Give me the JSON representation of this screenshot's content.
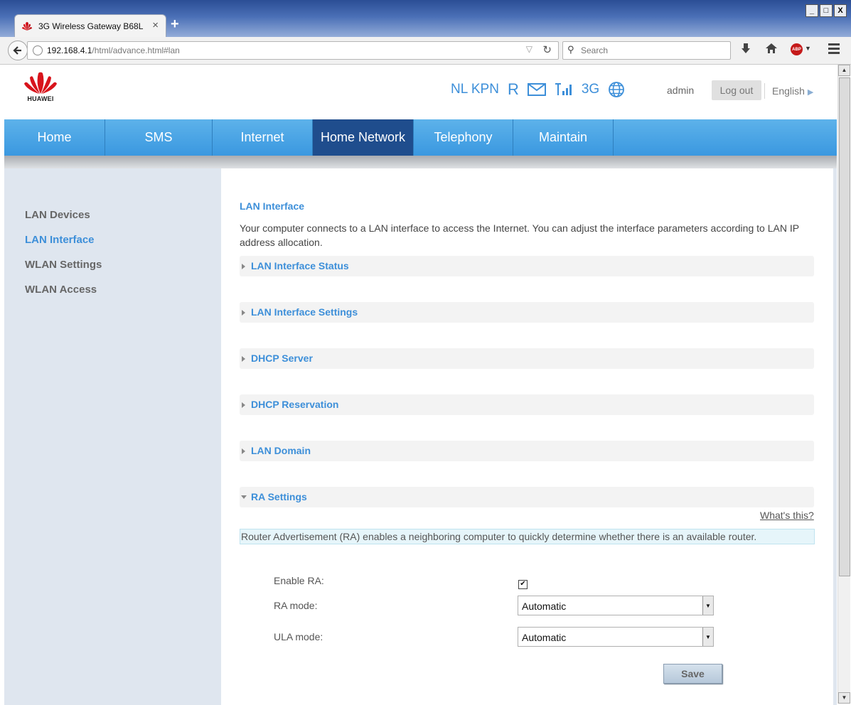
{
  "browser": {
    "tab_title": "3G Wireless Gateway B68L",
    "tab_close": "×",
    "new_tab": "+",
    "url_host": "192.168.4.1",
    "url_path": "/html/advance.html#lan",
    "search_placeholder": "Search",
    "window_buttons": [
      "_",
      "□",
      "X"
    ],
    "abp_label": "ABP"
  },
  "header": {
    "brand": "HUAWEI",
    "operator": "NL KPN",
    "roaming": "R",
    "network_type": "3G",
    "user": "admin",
    "logout_label": "Log out",
    "language": "English"
  },
  "nav": {
    "items": [
      "Home",
      "SMS",
      "Internet",
      "Home Network",
      "Telephony",
      "Maintain"
    ],
    "active": "Home Network"
  },
  "sidebar": {
    "items": [
      "LAN Devices",
      "LAN Interface",
      "WLAN Settings",
      "WLAN Access"
    ],
    "active": "LAN Interface"
  },
  "content": {
    "title": "LAN Interface",
    "description": "Your computer connects to a LAN interface to access the Internet. You can adjust the interface parameters according to LAN IP address allocation.",
    "sections": [
      "LAN Interface Status",
      "LAN Interface Settings",
      "DHCP Server",
      "DHCP Reservation",
      "LAN Domain",
      "RA Settings"
    ],
    "expanded_section": "RA Settings",
    "whats_this": "What's this?",
    "ra_info": "Router Advertisement (RA) enables a neighboring computer to quickly determine whether there is an available router.",
    "form": {
      "enable_ra_label": "Enable RA:",
      "enable_ra_checked": true,
      "ra_mode_label": "RA mode:",
      "ra_mode_value": "Automatic",
      "ula_mode_label": "ULA mode:",
      "ula_mode_value": "Automatic"
    },
    "save_label": "Save"
  },
  "colors": {
    "accent_blue": "#3d8fd9",
    "nav_blue": "#4aa6e6",
    "nav_active": "#1f4d8d",
    "sidebar_bg": "#dfe6ef",
    "huawei_red": "#d8141c"
  }
}
